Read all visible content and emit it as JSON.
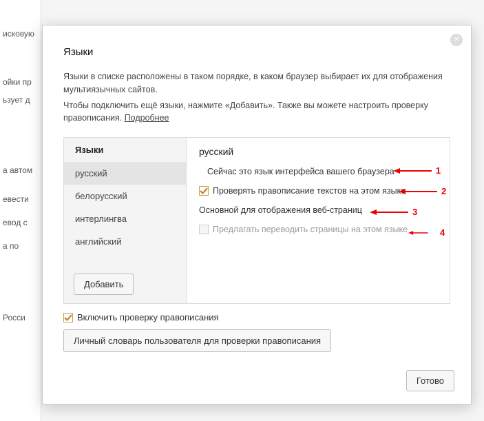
{
  "bg": {
    "items": [
      "исковую",
      "ойки пр",
      "ьзует д",
      "а автом",
      "евести",
      "евод с",
      "а по",
      "Росси"
    ]
  },
  "modal": {
    "title": "Языки",
    "intro1": "Языки в списке расположены в таком порядке, в каком браузер выбирает их для отображения мультиязычных сайтов.",
    "intro2_prefix": "Чтобы подключить ещё языки, нажмите «Добавить». Также вы можете настроить проверку правописания. ",
    "intro2_link": "Подробнее",
    "close_symbol": "×"
  },
  "langlist": {
    "header": "Языки",
    "items": [
      "русский",
      "белорусский",
      "интерлингва",
      "английский"
    ],
    "selected_index": 0,
    "add_label": "Добавить"
  },
  "detail": {
    "title": "русский",
    "row1": "Сейчас это язык интерфейса вашего браузера",
    "row2": "Проверять правописание текстов на этом языке",
    "row3": "Основной для отображения веб-страниц",
    "row4": "Предлагать переводить страницы на этом языке"
  },
  "annotations": {
    "n1": "1",
    "n2": "2",
    "n3": "3",
    "n4": "4"
  },
  "below": {
    "enable_spell": "Включить проверку правописания",
    "dict_button": "Личный словарь пользователя для проверки правописания"
  },
  "footer": {
    "done": "Готово"
  }
}
